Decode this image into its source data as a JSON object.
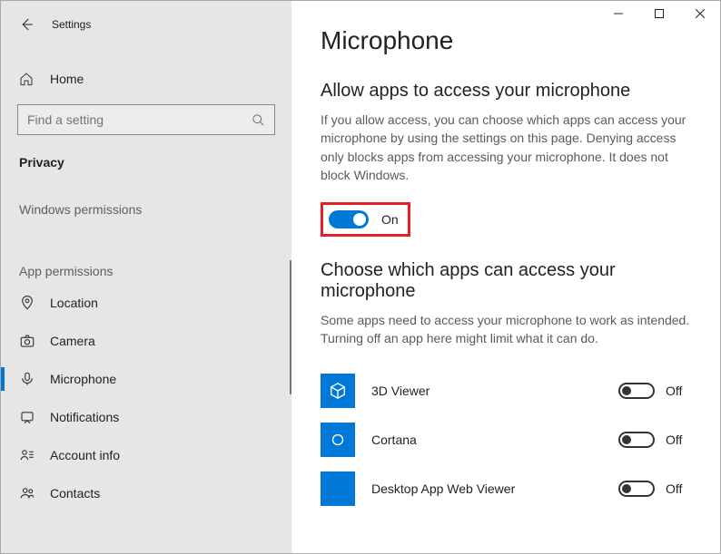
{
  "window": {
    "title": "Settings"
  },
  "sidebar": {
    "home": "Home",
    "search_placeholder": "Find a setting",
    "section": "Privacy",
    "group1": "Windows permissions",
    "group2": "App permissions",
    "items": {
      "location": "Location",
      "camera": "Camera",
      "microphone": "Microphone",
      "notifications": "Notifications",
      "account": "Account info",
      "contacts": "Contacts"
    }
  },
  "main": {
    "title": "Microphone",
    "allow_heading": "Allow apps to access your microphone",
    "allow_desc": "If you allow access, you can choose which apps can access your microphone by using the settings on this page. Denying access only blocks apps from accessing your microphone. It does not block Windows.",
    "master_toggle_label": "On",
    "choose_heading": "Choose which apps can access your microphone",
    "choose_desc": "Some apps need to access your microphone to work as intended. Turning off an app here might limit what it can do.",
    "apps": [
      {
        "name": "3D  Viewer",
        "state": "Off"
      },
      {
        "name": "Cortana",
        "state": "Off"
      },
      {
        "name": "Desktop App Web Viewer",
        "state": "Off"
      }
    ]
  }
}
